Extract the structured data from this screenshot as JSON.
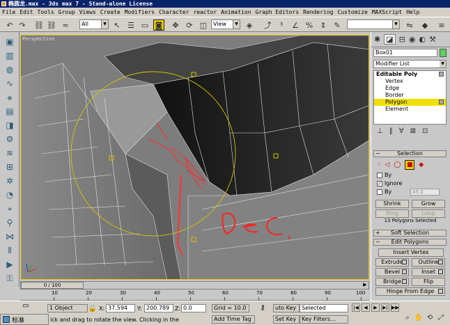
{
  "window": {
    "title": "椭圆龙.max - 3ds max 7 - Stand-alone License"
  },
  "menu": [
    "File",
    "Edit",
    "Tools",
    "Group",
    "Views",
    "Create",
    "Modifiers",
    "Character",
    "reactor",
    "Animation",
    "Graph Editors",
    "Rendering",
    "Customize",
    "MAXScript",
    "Help"
  ],
  "toolbar": {
    "selection_filter": "All",
    "reference_coord": "View"
  },
  "viewport": {
    "label": "Perspective",
    "annotation_text": "Dec."
  },
  "command_panel": {
    "object_name": "Box01",
    "modifier_list": "Modifier List",
    "stack": {
      "root": "Editable Poly",
      "items": [
        "Vertex",
        "Edge",
        "Border",
        "Polygon",
        "Element"
      ],
      "selected": "Polygon"
    },
    "selection": {
      "title": "Selection",
      "by_vertex": "By",
      "ignore_backfacing": "Ignore",
      "by_angle": "By",
      "angle_value": "45.0",
      "shrink": "Shrink",
      "grow": "Grow",
      "ring": "Ring",
      "loop": "Loop",
      "status": "13 Polygons Selected"
    },
    "soft_selection": "Soft Selection",
    "edit_polygons": {
      "title": "Edit Polygons",
      "insert_vertex": "Insert Vertex",
      "extrude": "Extrude",
      "outline": "Outline",
      "bevel": "Bevel",
      "inset": "Inset",
      "bridge": "Bridge",
      "flip": "Flip",
      "hinge": "Hinge From Edge"
    }
  },
  "timeline": {
    "frame": "0 / 100",
    "ticks": [
      "10",
      "20",
      "30",
      "40",
      "50",
      "60",
      "70",
      "80",
      "90",
      "100"
    ]
  },
  "status": {
    "selection": "1 Object",
    "x_label": "X:",
    "x_value": "37.594",
    "y_label": "Y:",
    "y_value": "200.789",
    "z_label": "Z:",
    "z_value": "0.0",
    "grid": "Grid = 10.0",
    "prompt": "ick and drag to rotate the view.  Clicking in the",
    "add_time_tag": "Add Time Tag",
    "auto_key": "uto Key",
    "set_key": "Set Key",
    "key_mode": "Selected",
    "key_filters": "Key Filters...",
    "taskbar_label": "标准"
  }
}
